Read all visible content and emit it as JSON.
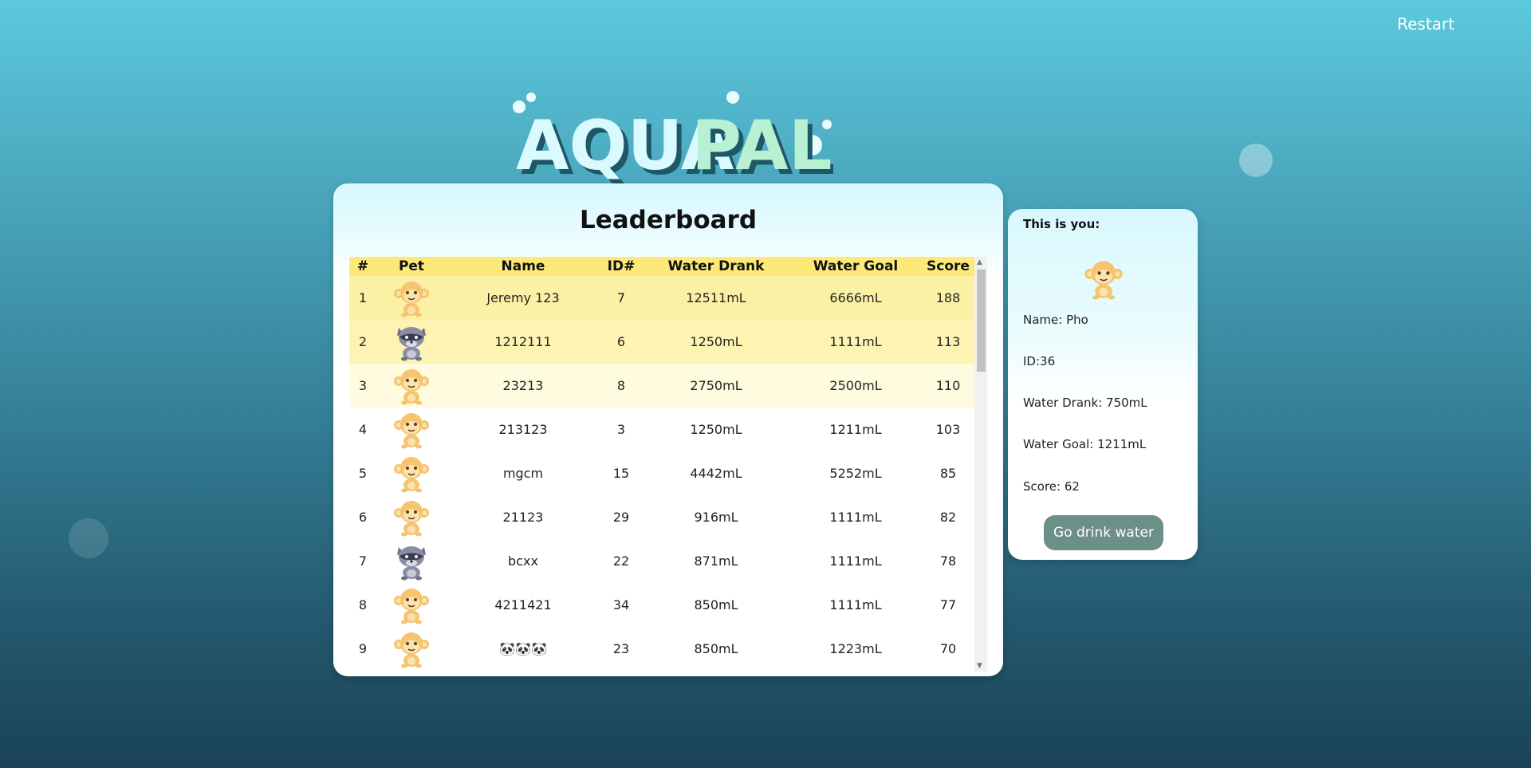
{
  "header": {
    "restart_label": "Restart"
  },
  "logo": {
    "part1": "AQUA",
    "part2": "PAL"
  },
  "leaderboard": {
    "title": "Leaderboard",
    "columns": [
      "#",
      "Pet",
      "Name",
      "ID#",
      "Water Drank",
      "Water Goal",
      "Score"
    ],
    "rows": [
      {
        "rank": "1",
        "pet": "monkey",
        "name": "Jeremy 123",
        "id": "7",
        "drank": "12511mL",
        "goal": "6666mL",
        "score": "188"
      },
      {
        "rank": "2",
        "pet": "raccoon",
        "name": "1212111",
        "id": "6",
        "drank": "1250mL",
        "goal": "1111mL",
        "score": "113"
      },
      {
        "rank": "3",
        "pet": "monkey",
        "name": "23213",
        "id": "8",
        "drank": "2750mL",
        "goal": "2500mL",
        "score": "110"
      },
      {
        "rank": "4",
        "pet": "monkey",
        "name": "213123",
        "id": "3",
        "drank": "1250mL",
        "goal": "1211mL",
        "score": "103"
      },
      {
        "rank": "5",
        "pet": "monkey",
        "name": "mgcm",
        "id": "15",
        "drank": "4442mL",
        "goal": "5252mL",
        "score": "85"
      },
      {
        "rank": "6",
        "pet": "monkey",
        "name": "21123",
        "id": "29",
        "drank": "916mL",
        "goal": "1111mL",
        "score": "82"
      },
      {
        "rank": "7",
        "pet": "raccoon",
        "name": "bcxx",
        "id": "22",
        "drank": "871mL",
        "goal": "1111mL",
        "score": "78"
      },
      {
        "rank": "8",
        "pet": "monkey",
        "name": "4211421",
        "id": "34",
        "drank": "850mL",
        "goal": "1111mL",
        "score": "77"
      },
      {
        "rank": "9",
        "pet": "monkey",
        "name": "🐼🐼🐼",
        "id": "23",
        "drank": "850mL",
        "goal": "1223mL",
        "score": "70"
      }
    ]
  },
  "you": {
    "title": "This is you:",
    "pet": "monkey",
    "name": "Name: Pho",
    "id": "ID:36",
    "drank": "Water Drank: 750mL",
    "goal": "Water Goal: 1211mL",
    "score": "Score: 62",
    "button_label": "Go drink water"
  },
  "colors": {
    "header_row": "#fde978",
    "button": "#6c8f87",
    "logo_aqua": "#d9fbff",
    "logo_pal": "#b7f0d3",
    "logo_outline": "#1e5765"
  }
}
